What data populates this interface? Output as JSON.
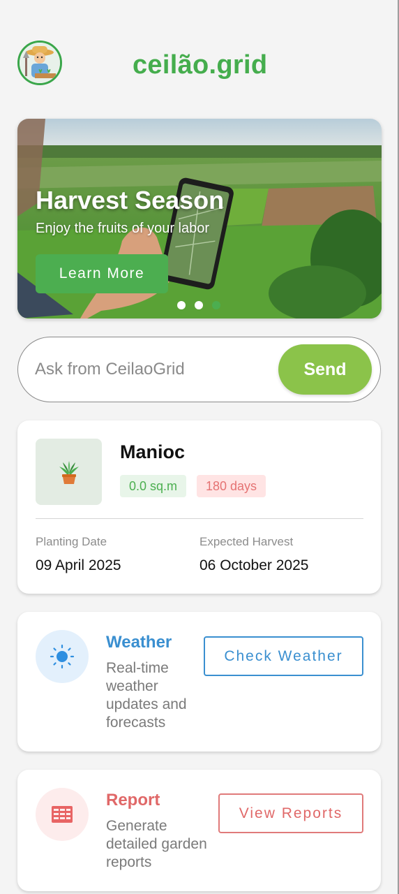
{
  "app": {
    "title": "ceilão.grid",
    "brand_color": "#45ad4d"
  },
  "banner": {
    "title": "Harvest Season",
    "subtitle": "Enjoy the fruits of your labor",
    "cta_label": "Learn More",
    "slide_count": 3,
    "active_slide": 3
  },
  "ask": {
    "placeholder": "Ask from CeilaoGrid",
    "value": "",
    "send_label": "Send"
  },
  "crop": {
    "name": "Manioc",
    "icon": "potted-plant-icon",
    "area": "0.0 sq.m",
    "duration": "180 days",
    "planting_label": "Planting Date",
    "planting_value": "09 April 2025",
    "harvest_label": "Expected Harvest",
    "harvest_value": "06 October 2025"
  },
  "weather": {
    "icon": "sun-icon",
    "title": "Weather",
    "description": "Real-time weather updates and forecasts",
    "button_label": "Check Weather",
    "color": "#3a8fd0"
  },
  "report": {
    "icon": "report-icon",
    "title": "Report",
    "description": "Generate detailed garden reports",
    "button_label": "View Reports",
    "color": "#e06868"
  }
}
